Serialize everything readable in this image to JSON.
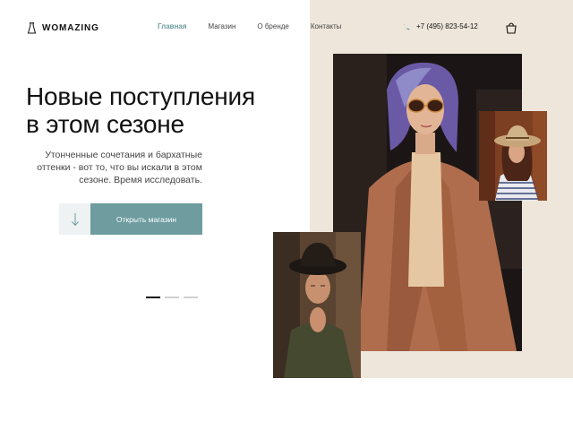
{
  "brand": {
    "name": "WOMAZING",
    "logo_icon": "dress-icon"
  },
  "nav": {
    "items": [
      {
        "label": "Главная",
        "active": true
      },
      {
        "label": "Магазин",
        "active": false
      },
      {
        "label": "О бренде",
        "active": false
      },
      {
        "label": "Контакты",
        "active": false
      }
    ]
  },
  "contact": {
    "phone": "+7 (495) 823-54-12",
    "phone_icon": "phone-icon"
  },
  "cart": {
    "icon": "shopping-bag-icon"
  },
  "hero": {
    "title_line1": "Новые поступления",
    "title_line2": "в этом сезоне",
    "subtitle": "Утонченные сочетания и бархатные оттенки - вот то, что вы искали в этом сезоне. Время исследовать.",
    "button_label": "Открыть магазин",
    "arrow_icon": "arrow-down-icon"
  },
  "slider": {
    "count": 3,
    "active_index": 0
  },
  "colors": {
    "accent": "#6e9c9f",
    "panel": "#efe6db",
    "text": "#111111"
  }
}
